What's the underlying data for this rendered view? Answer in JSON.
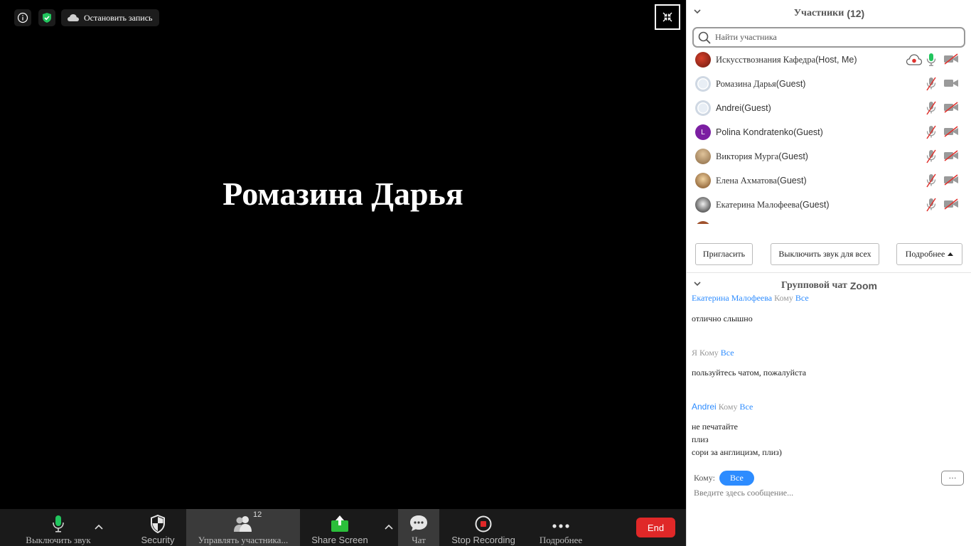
{
  "top_bar": {
    "recording_label": "Остановить запись"
  },
  "video": {
    "speaker_name": "Ромазина Дарья"
  },
  "toolbar": {
    "mute_label": "Выключить звук",
    "security_label": "Security",
    "participants_label": "Управлять участника...",
    "participants_count": "12",
    "share_label": "Share Screen",
    "chat_label": "Чат",
    "stop_recording_label": "Stop Recording",
    "more_label": "Подробнее",
    "end_label": "End"
  },
  "participants_panel": {
    "title": "Участники",
    "count": "(12)",
    "search_placeholder": "Найти участника",
    "participants": [
      {
        "name": "Искусствознания Кафедра",
        "role": "(Host, Me)",
        "avatar": "photo",
        "mic": "on",
        "camera": "off",
        "recording": true
      },
      {
        "name": "Ромазина Дарья",
        "role": "(Guest)",
        "avatar": "default",
        "mic": "muted",
        "camera": "on"
      },
      {
        "name": "Andrei",
        "role": "(Guest)",
        "avatar": "default",
        "mic": "muted",
        "camera": "off"
      },
      {
        "name": "Polina Kondratenko",
        "role": "(Guest)",
        "avatar": "L",
        "avatar_color": "#7b1fa2",
        "mic": "muted",
        "camera": "off"
      },
      {
        "name": "Виктория Мурга",
        "role": "(Guest)",
        "avatar": "photo",
        "mic": "muted",
        "camera": "off"
      },
      {
        "name": "Елена Ахматова",
        "role": "(Guest)",
        "avatar": "photo",
        "mic": "muted",
        "camera": "off"
      },
      {
        "name": "Екатерина Малофеева",
        "role": "(Guest)",
        "avatar": "photo",
        "mic": "muted",
        "camera": "off"
      }
    ],
    "invite_label": "Пригласить",
    "mute_all_label": "Выключить звук для всех",
    "more_label": "Подробнее"
  },
  "chat_panel": {
    "title": "Групповой чат",
    "title_brand": "Zoom",
    "messages": [
      {
        "sender": "Екатерина Малофеева",
        "to_word": "Кому",
        "to": "Все",
        "lines": [
          "отлично слышно"
        ]
      },
      {
        "sender": "Я",
        "to_word": "Кому",
        "to": "Все",
        "lines": [
          "пользуйтесь чатом, пожалуйста"
        ]
      },
      {
        "sender": "Andrei",
        "to_word": "Кому",
        "to": "Все",
        "lines": [
          "не печатайте",
          "плиз",
          "сори за англицизм, плиз)"
        ]
      }
    ],
    "to_label": "Кому:",
    "to_value": "Все",
    "more_label": "···",
    "input_placeholder": "Введите здесь сообщение..."
  },
  "colors": {
    "accent_blue": "#2d8cff",
    "end_red": "#e02828",
    "mic_green": "#22c55e",
    "muted_red": "#e0322e"
  }
}
